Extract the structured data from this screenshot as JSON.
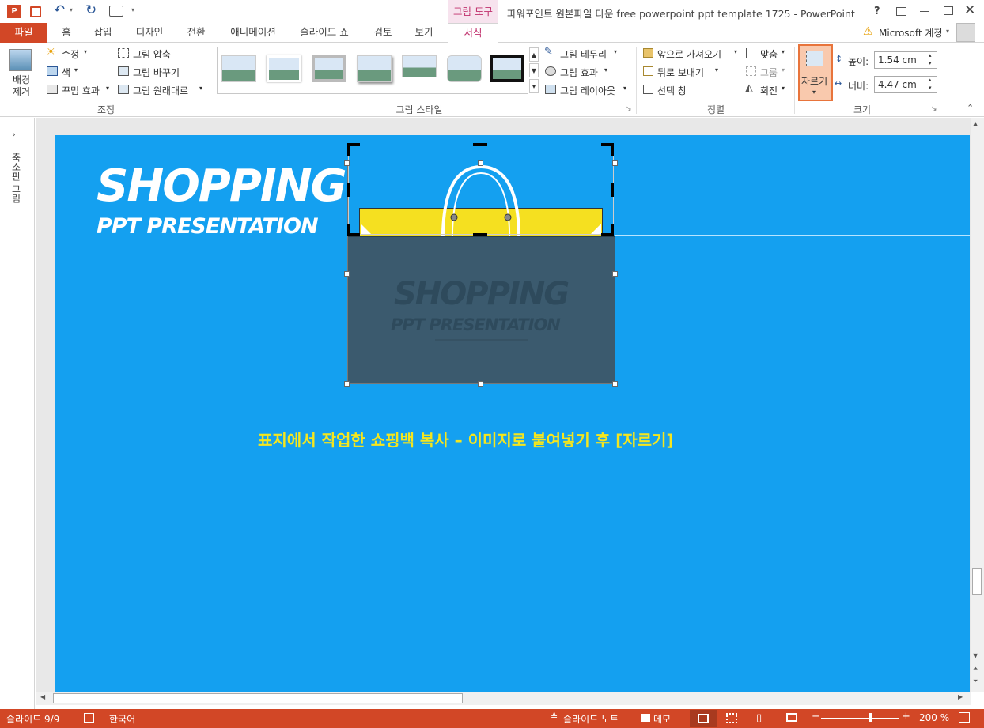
{
  "app": {
    "title": "파워포인트 원본파일 다운 free powerpoint ppt template 1725 - PowerPoint",
    "context_tab_group": "그림 도구",
    "help": "?",
    "account": "Microsoft 계정"
  },
  "tabs": [
    "파일",
    "홈",
    "삽입",
    "디자인",
    "전환",
    "애니메이션",
    "슬라이드 쇼",
    "검토",
    "보기",
    "서식"
  ],
  "ribbon": {
    "remove_bg": "배경 제거",
    "correct": "수정",
    "color": "색",
    "artistic": "꾸밈 효과",
    "compress": "그림 압축",
    "change": "그림 바꾸기",
    "reset": "그림 원래대로",
    "group_adjust": "조정",
    "group_styles": "그림 스타일",
    "border": "그림 테두리",
    "effects": "그림 효과",
    "layout": "그림 레이아웃",
    "bring_forward": "앞으로 가져오기",
    "send_backward": "뒤로 보내기",
    "selection_pane": "선택 창",
    "align": "맞춤",
    "group": "그룹",
    "rotate": "회전",
    "group_arrange": "정렬",
    "crop": "자르기",
    "height_label": "높이:",
    "height_value": "1.54 cm",
    "width_label": "너비:",
    "width_value": "4.47 cm",
    "group_size": "크기"
  },
  "leftpane": {
    "label": "축소판 그림"
  },
  "slide": {
    "title_main": "SHOPPING",
    "title_sub": "PPT PRESENTATION",
    "bag_title_main": "SHOPPING",
    "bag_title_sub": "PPT PRESENTATION",
    "caption": "표지에서 작업한 쇼핑백 복사 – 이미지로 붙여넣기 후 [자르기]"
  },
  "status": {
    "slide_counter": "슬라이드 9/9",
    "language": "한국어",
    "notes": "슬라이드 노트",
    "comments": "메모",
    "zoom": "200 %"
  },
  "colors": {
    "accent": "#d24726",
    "slide_bg": "#14a0f0",
    "caption": "#f5e61e",
    "bag_body": "#3b5a6e",
    "bag_top": "#f5e020"
  }
}
